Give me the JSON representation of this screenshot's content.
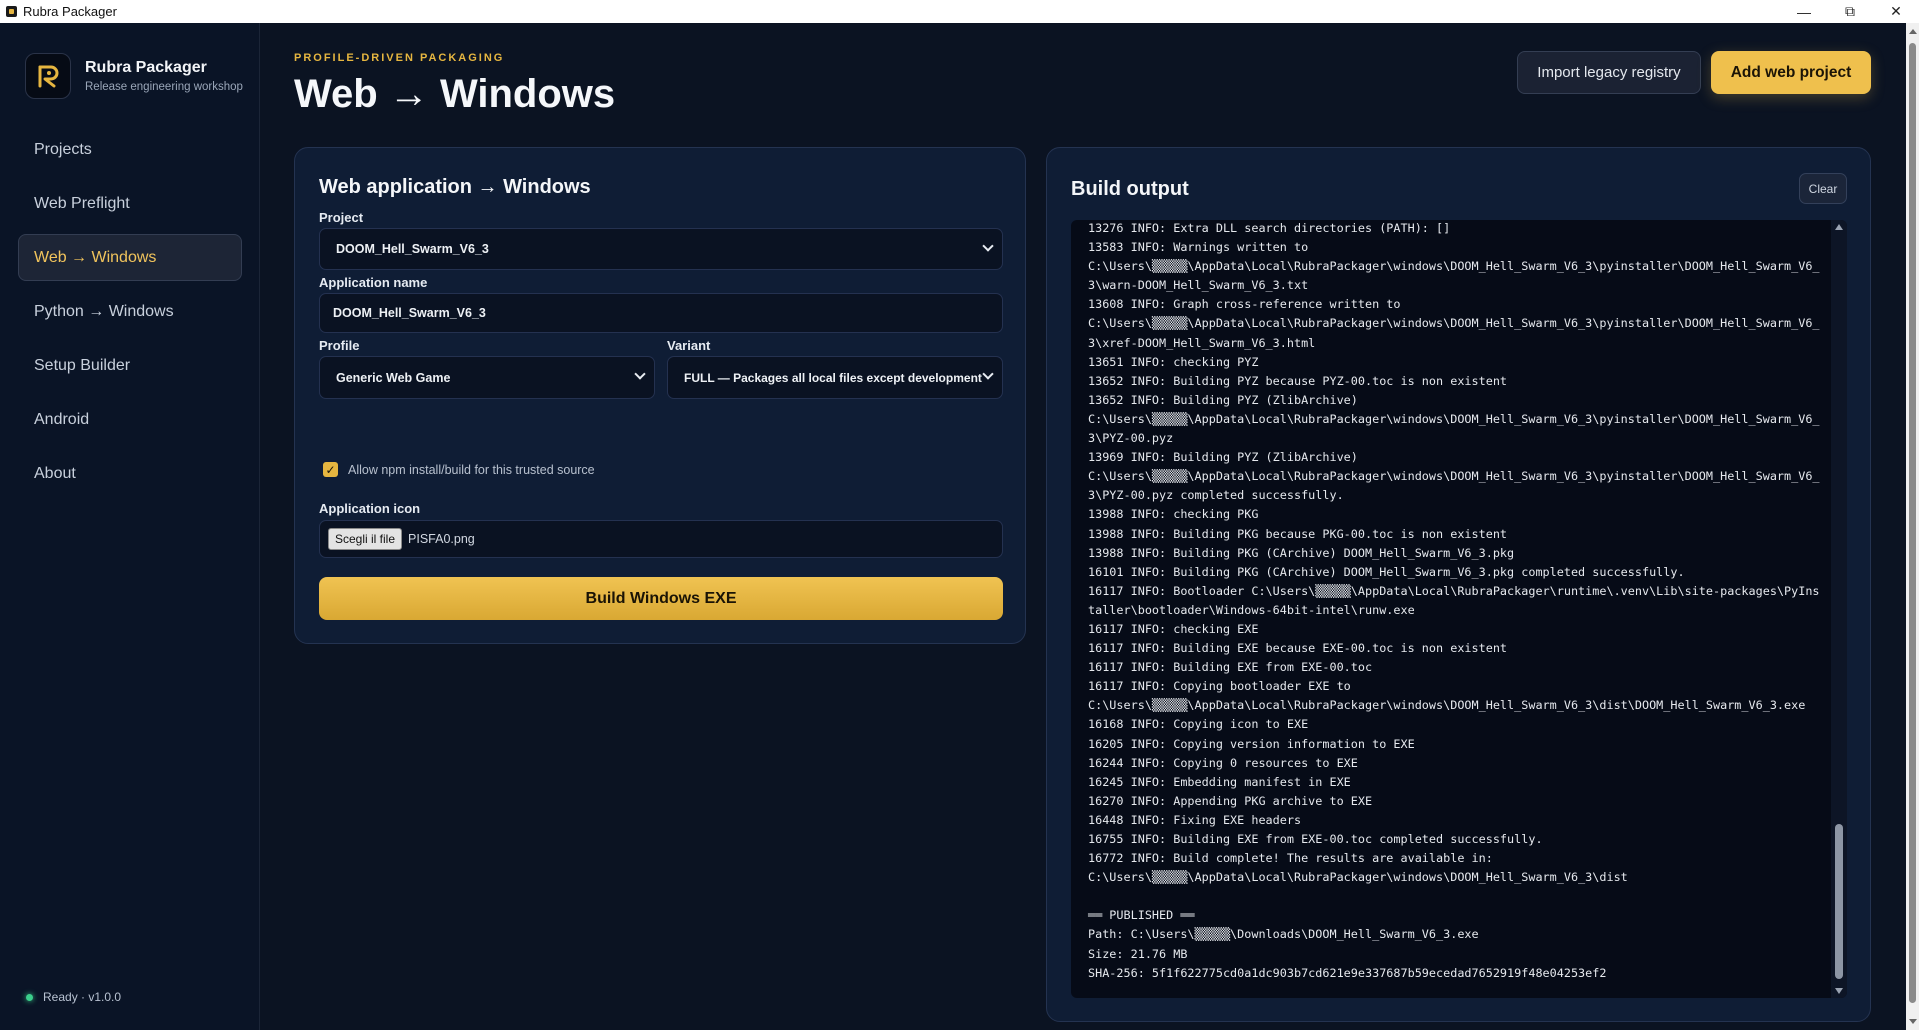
{
  "window": {
    "title": "Rubra Packager",
    "icon": "app-icon"
  },
  "sidebar": {
    "brand_name": "Rubra Packager",
    "brand_sub": "Release engineering workshop",
    "items": [
      {
        "label": "Projects"
      },
      {
        "label": "Web Preflight"
      },
      {
        "label": "Web → Windows",
        "active": true
      },
      {
        "label": "Python → Windows"
      },
      {
        "label": "Setup Builder"
      },
      {
        "label": "Android"
      },
      {
        "label": "About"
      }
    ],
    "status": "Ready · v1.0.0"
  },
  "header": {
    "eyebrow": "PROFILE-DRIVEN PACKAGING",
    "title": "Web → Windows",
    "import_label": "Import legacy registry",
    "add_label": "Add web project"
  },
  "form": {
    "title": "Web application → Windows",
    "project_label": "Project",
    "project_value": "DOOM_Hell_Swarm_V6_3",
    "appname_label": "Application name",
    "appname_value": "DOOM_Hell_Swarm_V6_3",
    "profile_label": "Profile",
    "profile_value": "Generic Web Game",
    "variant_label": "Variant",
    "variant_value": "FULL — Packages all local files except development",
    "npm_label": "Allow npm install/build for this trusted source",
    "npm_checked": true,
    "icon_label": "Application icon",
    "file_button": "Scegli il file",
    "file_name": "PISFA0.png",
    "build_label": "Build Windows EXE"
  },
  "output": {
    "title": "Build output",
    "clear_label": "Clear",
    "log": "13276 INFO: Extra DLL search directories (PATH): []\n13583 INFO: Warnings written to\nC:\\Users\\▒▒▒▒▒\\AppData\\Local\\RubraPackager\\windows\\DOOM_Hell_Swarm_V6_3\\pyinstaller\\DOOM_Hell_Swarm_V6_3\\warn-DOOM_Hell_Swarm_V6_3.txt\n13608 INFO: Graph cross-reference written to\nC:\\Users\\▒▒▒▒▒\\AppData\\Local\\RubraPackager\\windows\\DOOM_Hell_Swarm_V6_3\\pyinstaller\\DOOM_Hell_Swarm_V6_3\\xref-DOOM_Hell_Swarm_V6_3.html\n13651 INFO: checking PYZ\n13652 INFO: Building PYZ because PYZ-00.toc is non existent\n13652 INFO: Building PYZ (ZlibArchive)\nC:\\Users\\▒▒▒▒▒\\AppData\\Local\\RubraPackager\\windows\\DOOM_Hell_Swarm_V6_3\\pyinstaller\\DOOM_Hell_Swarm_V6_3\\PYZ-00.pyz\n13969 INFO: Building PYZ (ZlibArchive)\nC:\\Users\\▒▒▒▒▒\\AppData\\Local\\RubraPackager\\windows\\DOOM_Hell_Swarm_V6_3\\pyinstaller\\DOOM_Hell_Swarm_V6_3\\PYZ-00.pyz completed successfully.\n13988 INFO: checking PKG\n13988 INFO: Building PKG because PKG-00.toc is non existent\n13988 INFO: Building PKG (CArchive) DOOM_Hell_Swarm_V6_3.pkg\n16101 INFO: Building PKG (CArchive) DOOM_Hell_Swarm_V6_3.pkg completed successfully.\n16117 INFO: Bootloader C:\\Users\\▒▒▒▒▒\\AppData\\Local\\RubraPackager\\runtime\\.venv\\Lib\\site-packages\\PyInstaller\\bootloader\\Windows-64bit-intel\\runw.exe\n16117 INFO: checking EXE\n16117 INFO: Building EXE because EXE-00.toc is non existent\n16117 INFO: Building EXE from EXE-00.toc\n16117 INFO: Copying bootloader EXE to\nC:\\Users\\▒▒▒▒▒\\AppData\\Local\\RubraPackager\\windows\\DOOM_Hell_Swarm_V6_3\\dist\\DOOM_Hell_Swarm_V6_3.exe\n16168 INFO: Copying icon to EXE\n16205 INFO: Copying version information to EXE\n16244 INFO: Copying 0 resources to EXE\n16245 INFO: Embedding manifest in EXE\n16270 INFO: Appending PKG archive to EXE\n16448 INFO: Fixing EXE headers\n16755 INFO: Building EXE from EXE-00.toc completed successfully.\n16772 INFO: Build complete! The results are available in:\nC:\\Users\\▒▒▒▒▒\\AppData\\Local\\RubraPackager\\windows\\DOOM_Hell_Swarm_V6_3\\dist\n\n══ PUBLISHED ══\nPath: C:\\Users\\▒▒▒▒▒\\Downloads\\DOOM_Hell_Swarm_V6_3.exe\nSize: 21.76 MB\nSHA-256: 5f1f622775cd0a1dc903b7cd621e9e337687b59ecedad7652919f48e04253ef2"
  },
  "colors": {
    "accent": "#efc04d",
    "background": "#0b1322",
    "card": "#0f1d35",
    "status_ok": "#3bcf8b"
  }
}
